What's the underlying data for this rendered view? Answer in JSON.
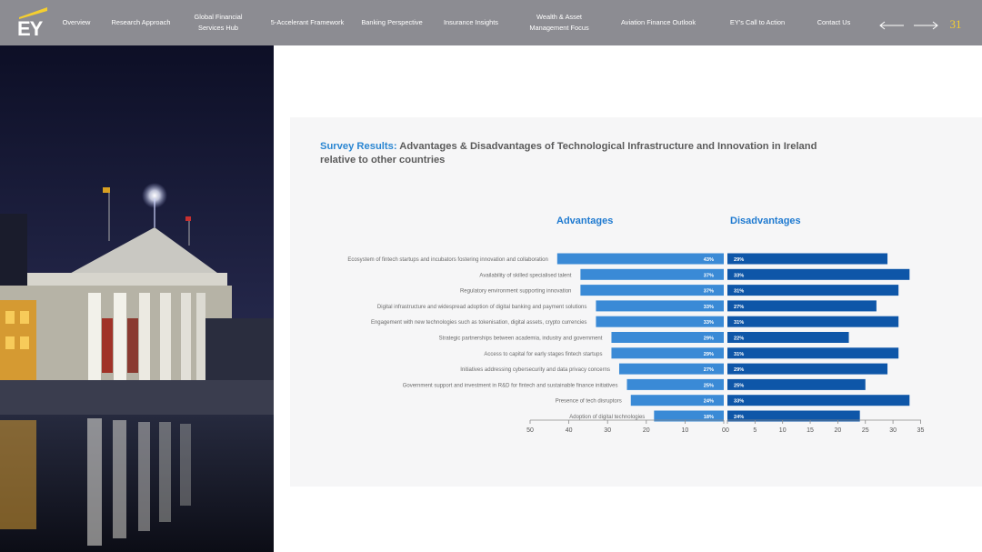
{
  "brand": {
    "logo_text": "EY"
  },
  "nav": {
    "items": [
      {
        "label": "Overview",
        "name": "nav-overview"
      },
      {
        "label": "Research Approach",
        "name": "nav-research-approach"
      },
      {
        "label": "Global Financial Services Hub",
        "name": "nav-global-financial-services-hub"
      },
      {
        "label": "5-Accelerant Framework",
        "name": "nav-5-accelerant-framework"
      },
      {
        "label": "Banking Perspective",
        "name": "nav-banking-perspective"
      },
      {
        "label": "Insurance Insights",
        "name": "nav-insurance-insights"
      },
      {
        "label": "Wealth & Asset Management Focus",
        "name": "nav-wealth-asset-management-focus"
      },
      {
        "label": "Aviation Finance Outlook",
        "name": "nav-aviation-finance-outlook"
      },
      {
        "label": "EY's Call to Action",
        "name": "nav-eys-call-to-action"
      },
      {
        "label": "Contact Us",
        "name": "nav-contact-us"
      }
    ],
    "page_number": "31",
    "prev_icon": "arrow-left-icon",
    "next_icon": "arrow-right-icon"
  },
  "colors": {
    "topbar": "#8c8c92",
    "page_number": "#f5cf2f",
    "title_accent": "#2a86d2",
    "advantages_bar": "#3a8ad6",
    "disadvantages_bar": "#0e56a8",
    "panel_bg": "#f6f6f7"
  },
  "page": {
    "title_accent": "Survey Results:",
    "title_rest": "Advantages & Disadvantages of Technological Infrastructure and Innovation in Ireland relative to other countries"
  },
  "chart_data": {
    "type": "bar",
    "orientation": "horizontal-diverging",
    "categories": [
      "Ecosystem of fintech startups and incubators fostering innovation and collaboration",
      "Availability of skilled specialised talent",
      "Regulatory environment supporting innovation",
      "Digital infrastructure and widespread adoption of digital banking and payment solutions",
      "Engagement with new technologies such as tokenisation, digital assets, crypto currencies",
      "Strategic partnerships between academia, industry and government",
      "Access to capital for early stages fintech startups",
      "Initiatives addressing cybersecurity and data privacy concerns",
      "Government support and investment in R&D for fintech and sustainable finance initiatives",
      "Presence of tech disruptors",
      "Adoption of digital technologies"
    ],
    "series": [
      {
        "name": "Advantages",
        "values": [
          43,
          37,
          37,
          33,
          33,
          29,
          29,
          27,
          25,
          24,
          18
        ],
        "labels": [
          "43%",
          "37%",
          "37%",
          "33%",
          "33%",
          "29%",
          "29%",
          "27%",
          "25%",
          "24%",
          "18%"
        ]
      },
      {
        "name": "Disadvantages",
        "values": [
          29,
          33,
          31,
          27,
          31,
          22,
          31,
          29,
          25,
          33,
          24
        ],
        "labels": [
          "29%",
          "33%",
          "31%",
          "27%",
          "31%",
          "22%",
          "31%",
          "29%",
          "25%",
          "33%",
          "24%"
        ]
      }
    ],
    "left_axis": {
      "ticks": [
        "50",
        "40",
        "30",
        "20",
        "10",
        "0"
      ],
      "range": [
        0,
        50
      ],
      "reversed": true
    },
    "right_axis": {
      "ticks": [
        "0",
        "5",
        "10",
        "15",
        "20",
        "25",
        "30",
        "35"
      ],
      "range": [
        0,
        35
      ]
    },
    "grid": false
  }
}
